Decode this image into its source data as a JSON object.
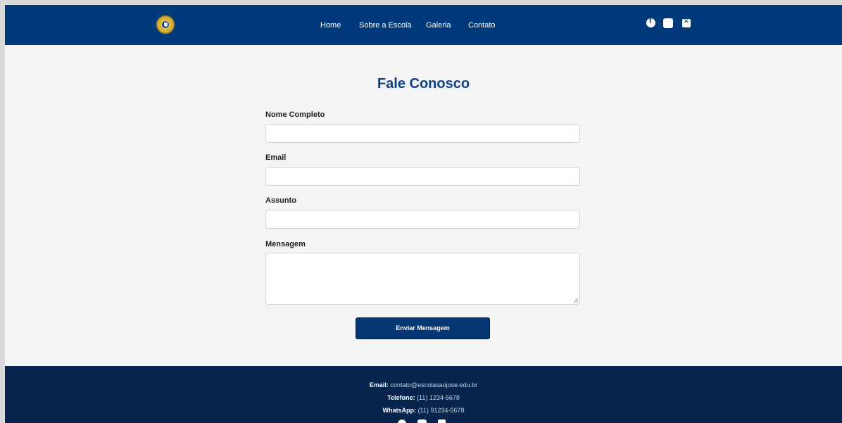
{
  "header": {
    "nav": [
      "Home",
      "Sobre a Escola",
      "Galeria",
      "Contato"
    ],
    "social_icons": [
      "facebook-icon",
      "instagram-icon",
      "x-icon"
    ],
    "background": "#003a7a"
  },
  "main": {
    "title": "Fale Conosco",
    "fields": {
      "name_label": "Nome Completo",
      "name_value": "",
      "email_label": "Email",
      "email_value": "",
      "subject_label": "Assunto",
      "subject_value": "",
      "message_label": "Mensagem",
      "message_value": ""
    },
    "submit_label": "Enviar Mensagem",
    "accent": "#0e3f87"
  },
  "footer": {
    "email_label": "Email:",
    "email_value": "contato@escolasaojose.edu.br",
    "phone_label": "Telefone:",
    "phone_value": "(11) 1234-5678",
    "whatsapp_label": "WhatsApp:",
    "whatsapp_value": "(11) 91234-5678",
    "social_icons": [
      "facebook-icon",
      "instagram-icon",
      "x-icon"
    ],
    "background": "#07244d"
  }
}
